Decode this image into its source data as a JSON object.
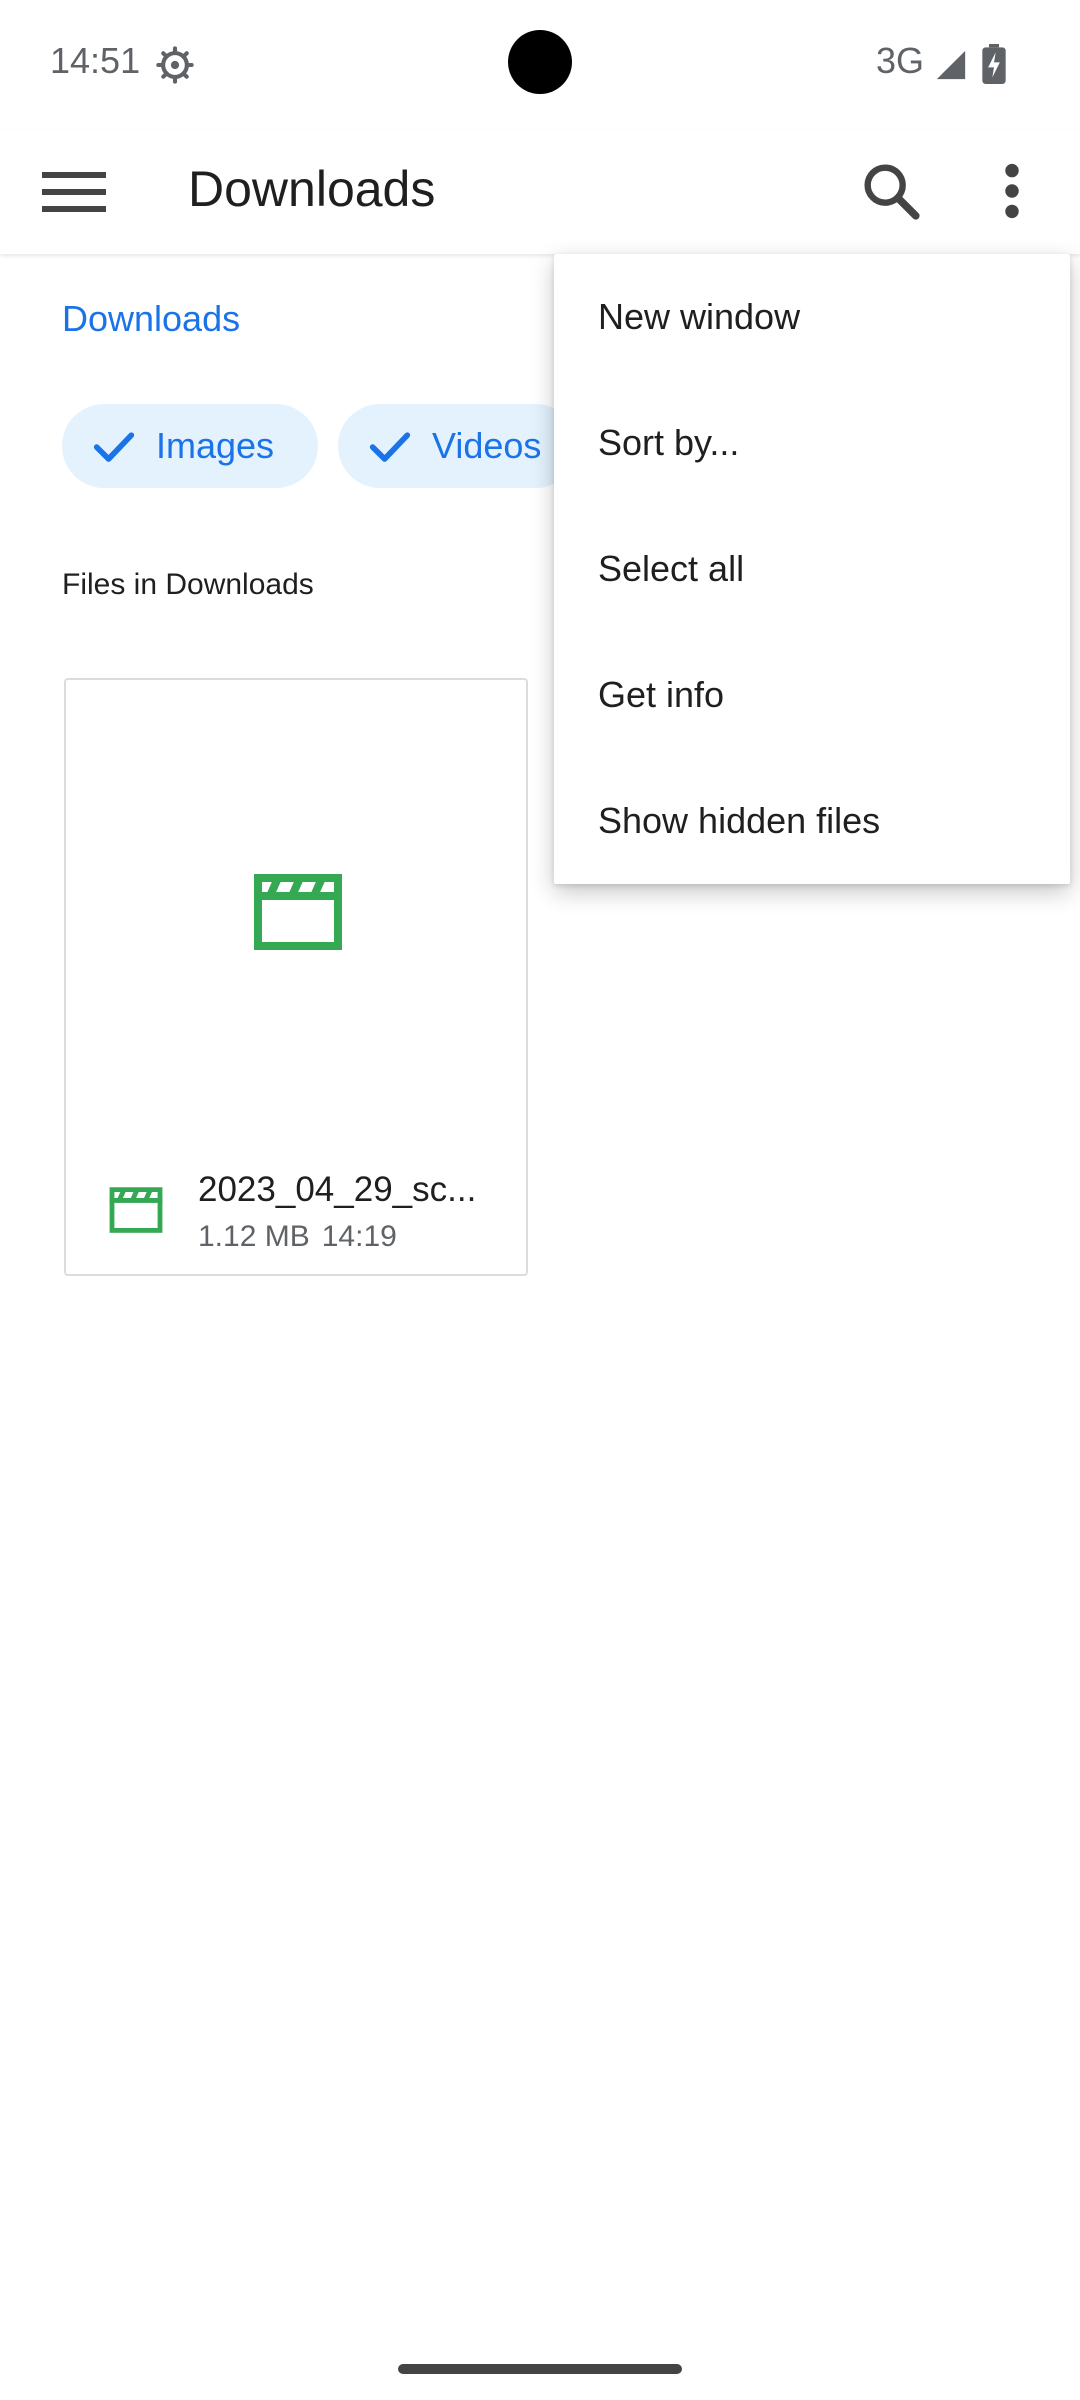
{
  "status_bar": {
    "time": "14:51",
    "network": "3G",
    "icons": [
      "settings-gear-icon",
      "signal-icon",
      "battery-charging-icon"
    ]
  },
  "app_bar": {
    "title": "Downloads",
    "icons": [
      "menu-icon",
      "search-icon",
      "more-vert-icon"
    ]
  },
  "breadcrumb": "Downloads",
  "chips": [
    {
      "label": "Images",
      "icon": "check-icon",
      "selected": true
    },
    {
      "label": "Videos",
      "icon": "check-icon",
      "selected": true
    }
  ],
  "section_header": "Files in Downloads",
  "files": [
    {
      "name": "2023_04_29_sc...",
      "size": "1.12 MB",
      "time": "14:19",
      "icon": "video-clapper-icon"
    }
  ],
  "menu": {
    "items": [
      {
        "label": "New window"
      },
      {
        "label": "Sort by..."
      },
      {
        "label": "Select all"
      },
      {
        "label": "Get info"
      },
      {
        "label": "Show hidden files"
      }
    ]
  },
  "colors": {
    "accent": "#1a73e8",
    "chip_bg": "#e3f2fd",
    "video_icon": "#34a853",
    "secondary_text": "#5f6368"
  }
}
